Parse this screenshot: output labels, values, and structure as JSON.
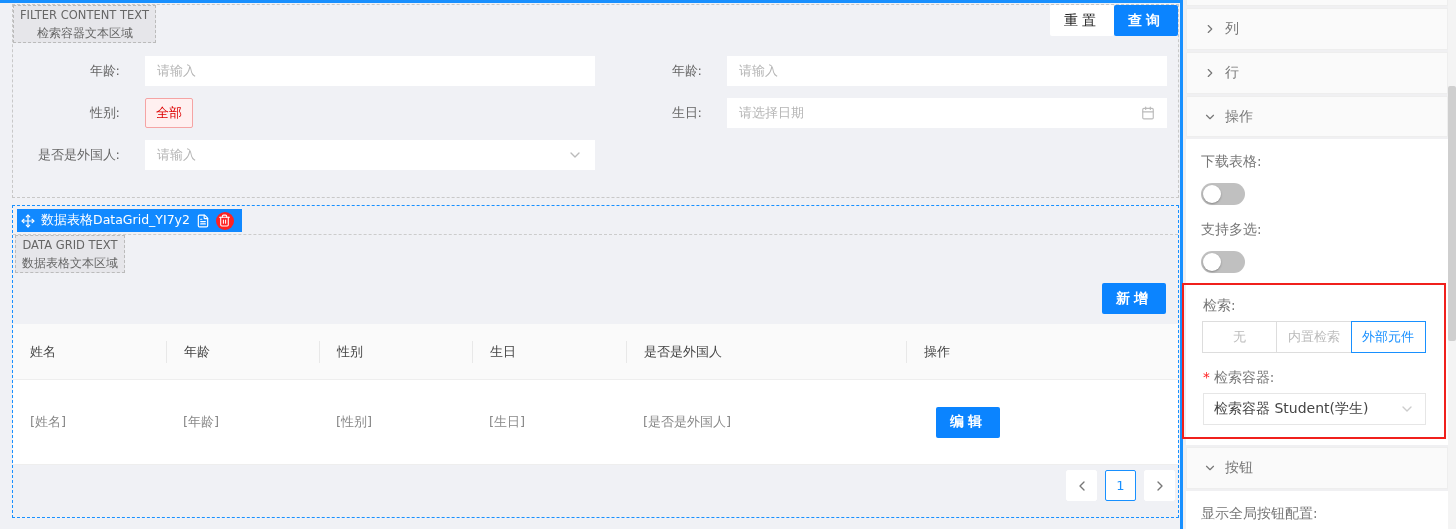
{
  "filter": {
    "caption": [
      "FILTER CONTENT TEXT",
      "检索容器文本区域"
    ],
    "buttons": [
      {
        "label": "重置",
        "kind": "default"
      },
      {
        "label": "查询",
        "kind": "primary"
      }
    ],
    "fields": [
      {
        "label": "年龄:",
        "kind": "input",
        "placeholder": "请输入"
      },
      {
        "label": "年龄:",
        "kind": "input",
        "placeholder": "请输入"
      },
      {
        "label": "性别:",
        "kind": "tag",
        "value": "全部"
      },
      {
        "label": "生日:",
        "kind": "date",
        "placeholder": "请选择日期"
      },
      {
        "label": "是否是外国人:",
        "kind": "select",
        "placeholder": "请输入"
      }
    ]
  },
  "grid": {
    "toolbar_title": "数据表格DataGrid_YI7y2",
    "caption": [
      "DATA GRID TEXT",
      "数据表格文本区域"
    ],
    "add_button": "新增",
    "columns": [
      "姓名",
      "年龄",
      "性别",
      "生日",
      "是否是外国人",
      "操作"
    ],
    "rows": [
      {
        "cells": [
          "[姓名]",
          "[年龄]",
          "[性别]",
          "[生日]",
          "[是否是外国人]"
        ],
        "action": "编辑"
      }
    ],
    "pages": [
      {
        "label": "1",
        "selected": true
      }
    ]
  },
  "panel": {
    "sections": [
      {
        "title": "列",
        "expanded": false
      },
      {
        "title": "行",
        "expanded": false
      },
      {
        "title": "操作",
        "expanded": true,
        "items": [
          {
            "kind": "switch",
            "label": "下载表格:",
            "on": false
          },
          {
            "kind": "switch",
            "label": "支持多选:",
            "on": false
          },
          {
            "kind": "group",
            "outlined": true,
            "items": [
              {
                "kind": "segmented",
                "label": "检索:",
                "options": [
                  {
                    "label": "无",
                    "selected": false
                  },
                  {
                    "label": "内置检索",
                    "selected": false
                  },
                  {
                    "label": "外部元件",
                    "selected": true
                  }
                ]
              },
              {
                "kind": "select",
                "label": "检索容器:",
                "required_mark": "*",
                "value": "检索容器 Student(学生)"
              }
            ]
          }
        ]
      },
      {
        "title": "按钮",
        "expanded": true,
        "items": [
          {
            "kind": "label",
            "label": "显示全局按钮配置:"
          }
        ]
      }
    ]
  }
}
